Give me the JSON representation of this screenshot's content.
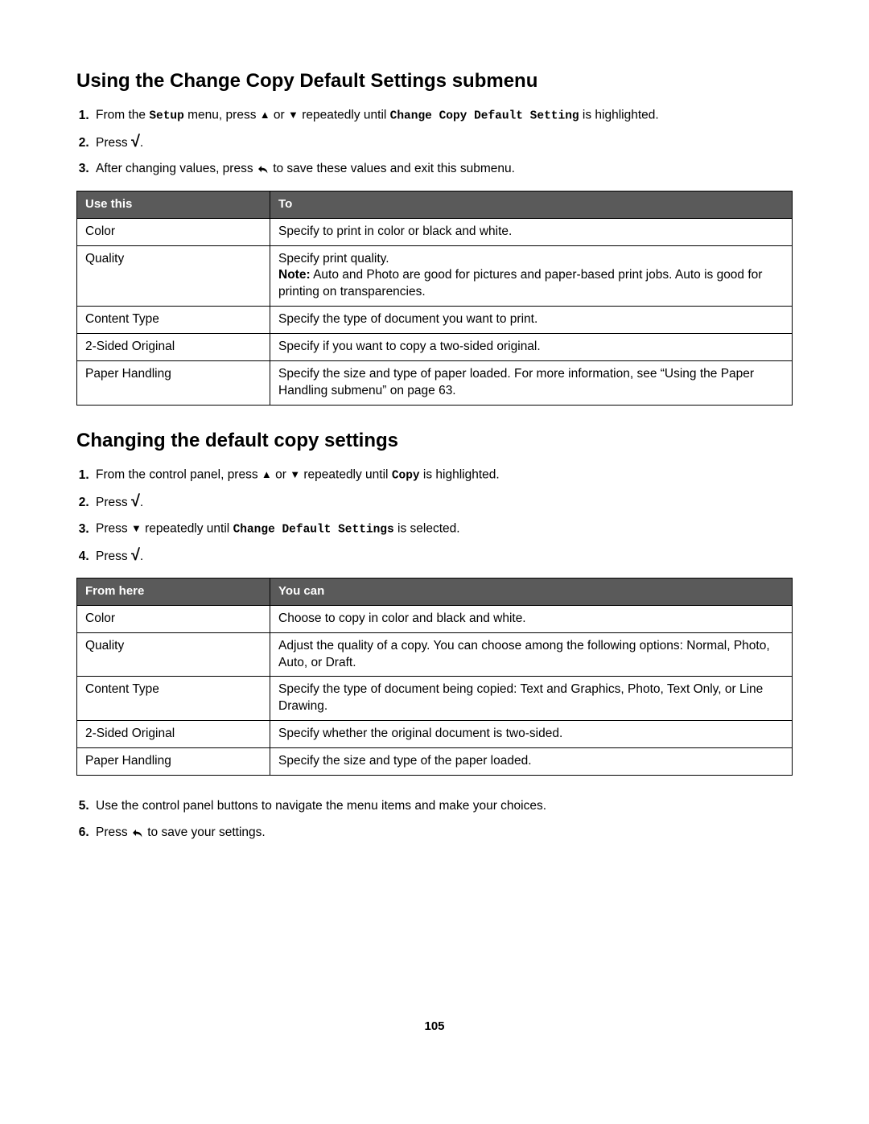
{
  "section1": {
    "heading": "Using the Change Copy Default Settings submenu",
    "steps": {
      "s1a": "From the ",
      "s1_setup": "Setup",
      "s1b": " menu, press ",
      "s1c": " or ",
      "s1d": " repeatedly until ",
      "s1_change": "Change Copy Default Setting",
      "s1e": " is highlighted.",
      "s2a": "Press ",
      "s2b": ".",
      "s3a": "After changing values, press ",
      "s3b": " to save these values and exit this submenu."
    },
    "table": {
      "h1": "Use this",
      "h2": "To",
      "rows": [
        {
          "c1": "Color",
          "c2": "Specify to print in color or black and white."
        },
        {
          "c1": "Quality",
          "c2": "Specify print quality.",
          "note_label": "Note:",
          "note": " Auto and Photo are good for pictures and paper-based print jobs. Auto is good for printing on transparencies."
        },
        {
          "c1": "Content Type",
          "c2": "Specify the type of document you want to print."
        },
        {
          "c1": "2-Sided Original",
          "c2": "Specify if you want to copy a two-sided original."
        },
        {
          "c1": "Paper Handling",
          "c2": "Specify the size and type of paper loaded. For more information, see “Using the Paper Handling submenu” on page 63."
        }
      ]
    }
  },
  "section2": {
    "heading": "Changing the default copy settings",
    "steps": {
      "s1a": "From the control panel, press ",
      "s1b": " or ",
      "s1c": " repeatedly until ",
      "s1_copy": "Copy",
      "s1d": " is highlighted.",
      "s2a": "Press ",
      "s2b": ".",
      "s3a": "Press ",
      "s3b": " repeatedly until ",
      "s3_change": "Change Default Settings",
      "s3c": " is selected.",
      "s4a": "Press ",
      "s4b": ".",
      "s5": "Use the control panel buttons to navigate the menu items and make your choices.",
      "s6a": "Press ",
      "s6b": " to save your settings."
    },
    "table": {
      "h1": "From here",
      "h2": "You can",
      "rows": [
        {
          "c1": "Color",
          "c2": "Choose to copy in color and black and white."
        },
        {
          "c1": "Quality",
          "c2": "Adjust the quality of a copy. You can choose among the following options: Normal, Photo, Auto, or Draft."
        },
        {
          "c1": "Content Type",
          "c2": "Specify the type of document being copied: Text and Graphics, Photo, Text Only, or Line Drawing."
        },
        {
          "c1": "2-Sided Original",
          "c2": "Specify whether the original document is two-sided."
        },
        {
          "c1": "Paper Handling",
          "c2": "Specify the size and type of the paper loaded."
        }
      ]
    }
  },
  "page_number": "105"
}
